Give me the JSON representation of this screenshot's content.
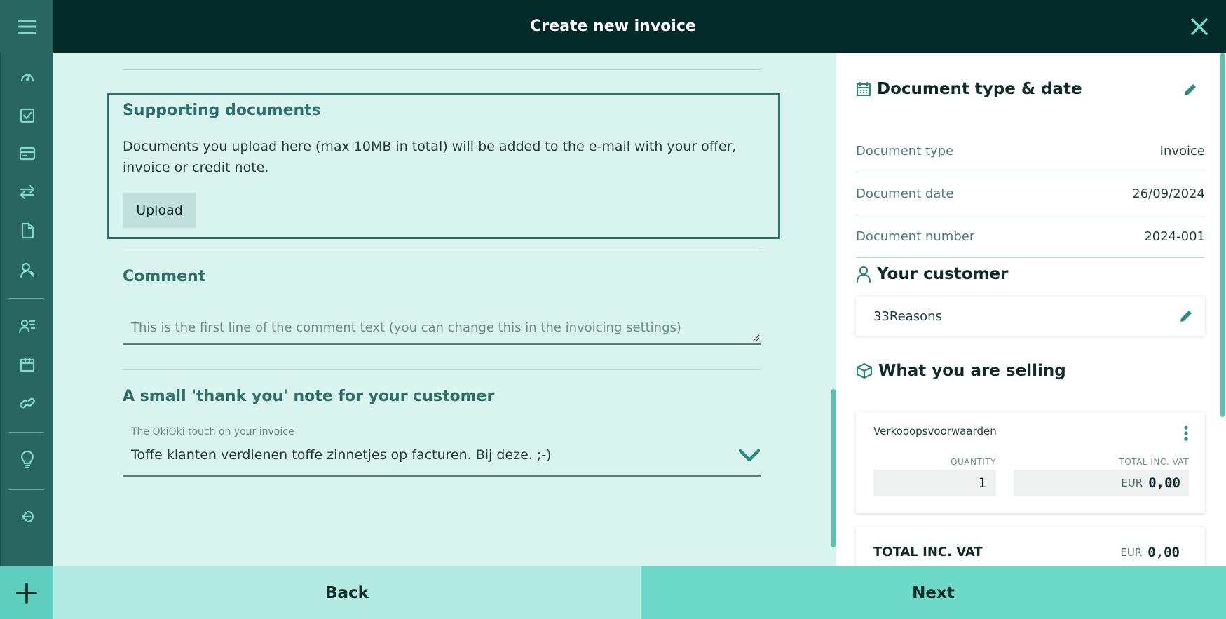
{
  "header": {
    "title": "Create new invoice"
  },
  "colors": {
    "topbar": "#022a29",
    "sidebar": "#2a6660",
    "accent": "#5fcfbf",
    "main_bg": "#d9f4ef"
  },
  "sidebar": {
    "items": [
      {
        "icon": "dashboard-gauge-icon"
      },
      {
        "icon": "checkbox-icon"
      },
      {
        "icon": "credit-card-icon"
      },
      {
        "icon": "transfer-arrows-icon"
      },
      {
        "icon": "document-icon"
      },
      {
        "icon": "handshake-icon"
      },
      {
        "icon": "contacts-list-icon"
      },
      {
        "icon": "box-icon"
      },
      {
        "icon": "link-icon"
      },
      {
        "icon": "lightbulb-icon"
      },
      {
        "icon": "logout-icon"
      }
    ]
  },
  "supporting": {
    "title": "Supporting documents",
    "description": "Documents you upload here (max 10MB in total) will be added to the e-mail with your offer, invoice or credit note.",
    "upload_label": "Upload"
  },
  "comment": {
    "title": "Comment",
    "placeholder": "This is the first line of the comment text (you can change this in the invoicing settings)"
  },
  "thankyou": {
    "title": "A small 'thank you' note for your customer",
    "select_label": "The OkiOki touch on your invoice",
    "select_value": "Toffe klanten verdienen toffe zinnetjes op facturen. Bij deze. ;-)"
  },
  "panel": {
    "doc_heading": "Document type & date",
    "rows": [
      {
        "label": "Document type",
        "value": "Invoice"
      },
      {
        "label": "Document date",
        "value": "26/09/2024"
      },
      {
        "label": "Document number",
        "value": "2024-001"
      }
    ],
    "customer_heading": "Your customer",
    "customer_name": "33Reasons",
    "selling_heading": "What you are selling",
    "product": {
      "name": "Verkooopsvoorwaarden",
      "quantity_label": "QUANTITY",
      "quantity": "1",
      "total_label": "TOTAL INC. VAT",
      "currency": "EUR",
      "total": "0,00"
    },
    "summary": {
      "label": "TOTAL INC. VAT",
      "currency": "EUR",
      "amount": "0,00"
    }
  },
  "footer": {
    "back_label": "Back",
    "next_label": "Next"
  }
}
